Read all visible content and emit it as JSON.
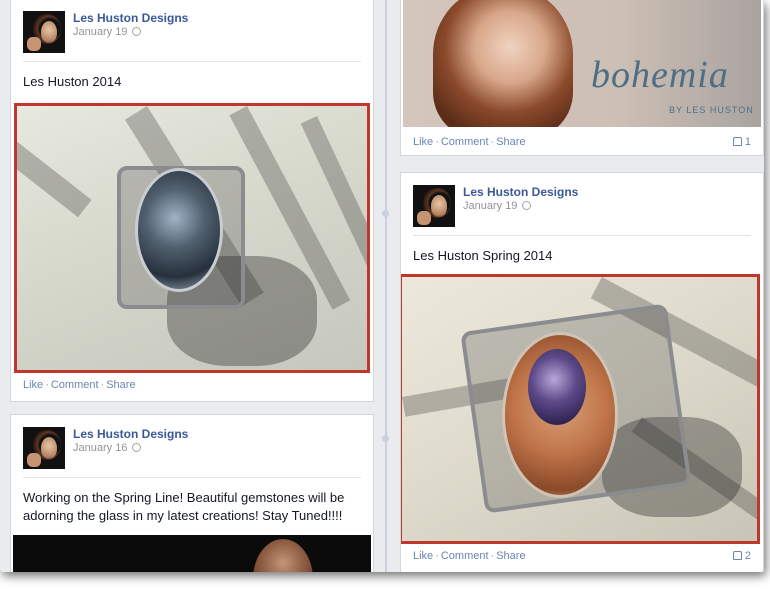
{
  "colors": {
    "highlight": "#c0382b",
    "link": "#3b5998",
    "action": "#6d84b4"
  },
  "posts": {
    "p1": {
      "author": "Les Huston Designs",
      "date": "January 19",
      "text": "Les Huston 2014",
      "actions": {
        "like": "Like",
        "comment": "Comment",
        "share": "Share"
      }
    },
    "p2": {
      "logo_text": "bohemia",
      "logo_sub": "BY LES HUSTON",
      "actions": {
        "like": "Like",
        "comment": "Comment",
        "share": "Share"
      },
      "like_count": "1"
    },
    "p3": {
      "author": "Les Huston Designs",
      "date": "January 19",
      "text": "Les Huston Spring 2014",
      "actions": {
        "like": "Like",
        "comment": "Comment",
        "share": "Share"
      },
      "like_count": "2"
    },
    "p4": {
      "author": "Les Huston Designs",
      "date": "January 16",
      "text": "Working on the Spring Line! Beautiful gemstones will be adorning the glass in my latest creations! Stay Tuned!!!!"
    }
  },
  "separator": "·"
}
